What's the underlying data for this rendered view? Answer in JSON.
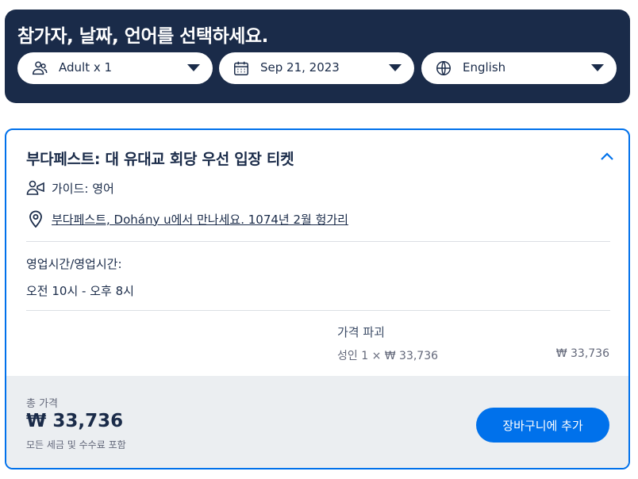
{
  "header": {
    "title": "참가자, 날짜, 언어를 선택하세요.",
    "participants": {
      "label": "Adult x 1",
      "icon": "people-icon"
    },
    "date": {
      "label": "Sep 21, 2023",
      "icon": "calendar-icon"
    },
    "language": {
      "label": "English",
      "icon": "globe-icon"
    }
  },
  "option": {
    "title": "부다페스트: 대 유대교 회당 우선 입장 티켓",
    "guide": "가이드: 영어",
    "meeting_point": "부다페스트, Dohány u에서 만나세요. 1074년 2월 헝가리",
    "hours_label": "영업시간/영업시간:",
    "hours_value": "오전 10시 - 오후 8시",
    "price_breakdown": {
      "label": "가격 파괴",
      "line_label": "성인 1 × ₩ 33,736",
      "line_total": "₩ 33,736"
    }
  },
  "footer": {
    "total_label": "총 가격",
    "total_value": "₩ 33,736",
    "tax_note": "모든 세금 및 수수료 포함",
    "add_to_cart": "장바구니에 추가"
  },
  "colors": {
    "navy": "#1a2b49",
    "accent": "#0071eb",
    "footer_bg": "#ebeef1"
  }
}
